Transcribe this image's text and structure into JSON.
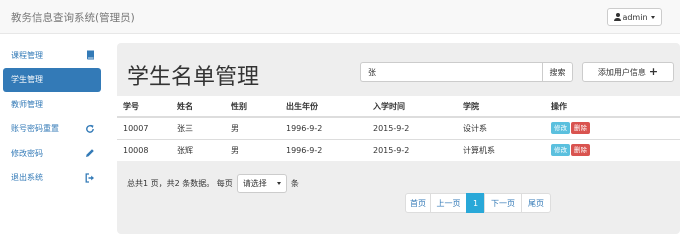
{
  "navbar": {
    "brand": "教务信息查询系统(管理员)",
    "user_label": "admin"
  },
  "sidebar": {
    "items": [
      {
        "label": "课程管理",
        "icon": "book-icon",
        "active": false
      },
      {
        "label": "学生管理",
        "icon": "",
        "active": true
      },
      {
        "label": "教师管理",
        "icon": "",
        "active": false
      },
      {
        "label": "账号密码重置",
        "icon": "refresh-icon",
        "active": false
      },
      {
        "label": "修改密码",
        "icon": "pencil-icon",
        "active": false
      },
      {
        "label": "退出系统",
        "icon": "logout-icon",
        "active": false
      }
    ]
  },
  "main": {
    "title": "学生名单管理",
    "search": {
      "value": "张",
      "button": "搜索"
    },
    "add_button": "添加用户信息"
  },
  "table": {
    "columns": [
      "学号",
      "姓名",
      "性别",
      "出生年份",
      "入学时间",
      "学院",
      "操作"
    ],
    "rows": [
      [
        "10007",
        "张三",
        "男",
        "1996-9-2",
        "2015-9-2",
        "设计系"
      ],
      [
        "10008",
        "张辉",
        "男",
        "1996-9-2",
        "2015-9-2",
        "计算机系"
      ]
    ],
    "edit_label": "修改",
    "delete_label": "删除"
  },
  "summary": {
    "prefix": "总共1 页，共2 条数据。 每页",
    "select_value": "请选择",
    "suffix": "条"
  },
  "pagination": {
    "first": "首页",
    "prev": "上一页",
    "current": "1",
    "next": "下一页",
    "last": "尾页"
  },
  "colors": {
    "primary": "#337ab7",
    "info": "#5bc0de",
    "danger": "#d9534f",
    "page_active": "#29a8d8"
  }
}
